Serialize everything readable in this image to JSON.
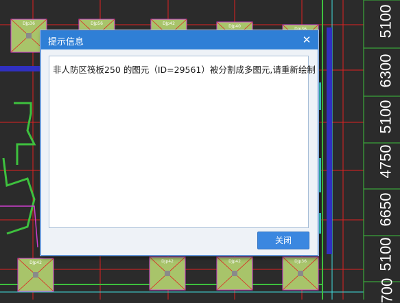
{
  "ruler": {
    "labels": [
      "5100",
      "6300",
      "5100",
      "4750",
      "6650",
      "5100",
      "700"
    ]
  },
  "dialog": {
    "title": "提示信息",
    "message": "非人防区筏板250 的图元（ID=29561）被分割成多图元,请重新绘制",
    "close_button": "关闭",
    "close_icon": "close-icon"
  },
  "cad": {
    "pile_labels": [
      "DJp36",
      "DJp56",
      "DJp42",
      "DJp40",
      "DJp36",
      "DJp42",
      "DJp42",
      "DJp42"
    ],
    "colors": {
      "background": "#2b2b2b",
      "axis_red": "#e02020",
      "wall_green": "#3ec13e",
      "pile_fill": "#a8c46a",
      "pile_border_magenta": "#d040d0",
      "cyan": "#40e0e0",
      "blue_hatch": "#3030c0",
      "column_gray": "#8a8a8a"
    }
  }
}
